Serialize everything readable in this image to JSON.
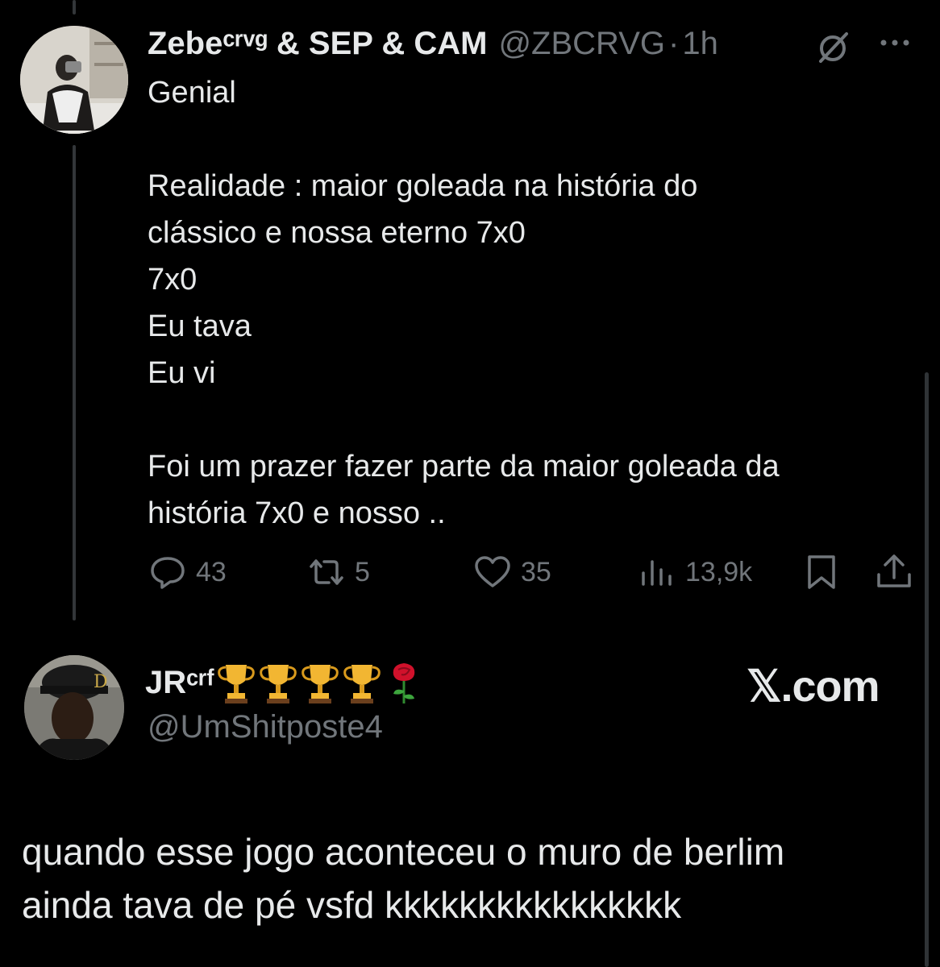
{
  "tweet": {
    "display_name": "Zebeᶜʳᵛᵍ & SEP & CAM",
    "handle": "@ZBCRVG",
    "separator": "·",
    "time": "1h",
    "body_lines": [
      "Genial",
      "",
      "Realidade : maior goleada na história do",
      "clássico e nossa eterno 7x0",
      "7x0",
      "Eu tava",
      "Eu vi",
      "",
      "Foi um prazer fazer parte da maior goleada da",
      "história 7x0 e nosso .."
    ],
    "actions": {
      "reply_count": "43",
      "retweet_count": "5",
      "like_count": "35",
      "view_count": "13,9k"
    },
    "icons": [
      "grok-icon",
      "more-icon",
      "reply-icon",
      "retweet-icon",
      "like-icon",
      "views-icon",
      "bookmark-icon",
      "share-icon"
    ]
  },
  "reply": {
    "display_name": "JRᶜʳᶠ",
    "emojis": [
      "trophy",
      "trophy",
      "trophy",
      "trophy",
      "rose"
    ],
    "handle": "@UmShitposte4",
    "brand": "𝕏.com",
    "body_lines": [
      "quando esse jogo aconteceu o muro de berlim",
      "ainda tava de pé vsfd kkkkkkkkkkkkkkkk"
    ]
  },
  "colors": {
    "background": "#000000",
    "primary_text": "#e7e9ea",
    "secondary_text": "#71767b",
    "thread_line": "#333639"
  }
}
